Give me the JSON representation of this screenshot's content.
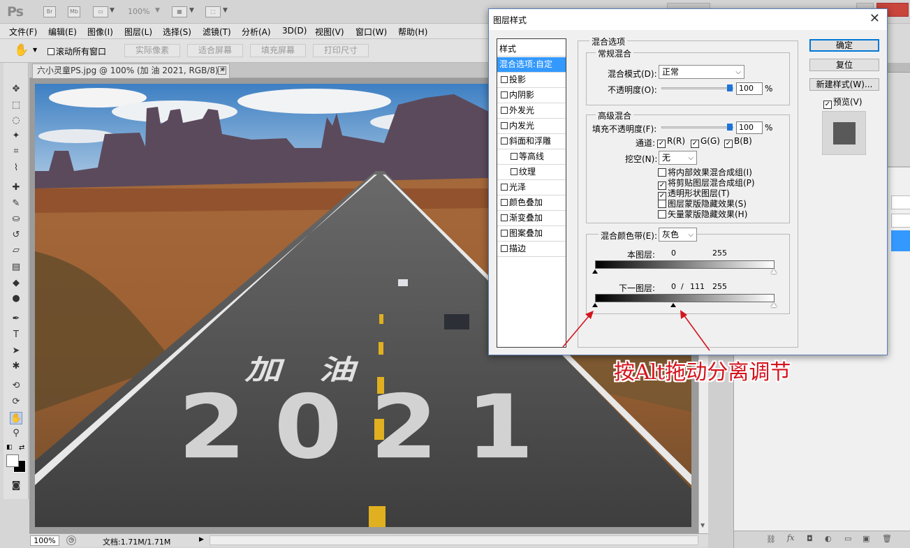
{
  "app": {
    "logo": "Ps",
    "titlebar_icons": [
      "Br",
      "Mb"
    ],
    "zoom": "100%"
  },
  "menu": [
    "文件(F)",
    "编辑(E)",
    "图像(I)",
    "图层(L)",
    "选择(S)",
    "滤镜(T)",
    "分析(A)",
    "3D(D)",
    "视图(V)",
    "窗口(W)",
    "帮助(H)"
  ],
  "options_bar": {
    "scroll_all": "滚动所有窗口",
    "actual_pixels": "实际像素",
    "fit_screen": "适合屏幕",
    "fill_screen": "填充屏幕",
    "print_size": "打印尺寸"
  },
  "document": {
    "tab_title": "六小灵童PS.jpg @ 100% (加 油 2021, RGB/8) *",
    "close": "✕",
    "zoom": "100%",
    "doc_info": "文档:1.71M/1.71M",
    "road_text_1": "加 油",
    "road_text_2": "2021"
  },
  "dialog": {
    "title": "图层样式",
    "close": "✕",
    "styles_header": "样式",
    "styles": [
      {
        "label": "混合选项:自定",
        "selected": true,
        "checkbox": false,
        "sub": false
      },
      {
        "label": "投影",
        "selected": false,
        "checkbox": true,
        "sub": false
      },
      {
        "label": "内阴影",
        "selected": false,
        "checkbox": true,
        "sub": false
      },
      {
        "label": "外发光",
        "selected": false,
        "checkbox": true,
        "sub": false
      },
      {
        "label": "内发光",
        "selected": false,
        "checkbox": true,
        "sub": false
      },
      {
        "label": "斜面和浮雕",
        "selected": false,
        "checkbox": true,
        "sub": false
      },
      {
        "label": "等高线",
        "selected": false,
        "checkbox": true,
        "sub": true
      },
      {
        "label": "纹理",
        "selected": false,
        "checkbox": true,
        "sub": true
      },
      {
        "label": "光泽",
        "selected": false,
        "checkbox": true,
        "sub": false
      },
      {
        "label": "颜色叠加",
        "selected": false,
        "checkbox": true,
        "sub": false
      },
      {
        "label": "渐变叠加",
        "selected": false,
        "checkbox": true,
        "sub": false
      },
      {
        "label": "图案叠加",
        "selected": false,
        "checkbox": true,
        "sub": false
      },
      {
        "label": "描边",
        "selected": false,
        "checkbox": true,
        "sub": false
      }
    ],
    "blend_options_title": "混合选项",
    "general_blending": "常规混合",
    "blend_mode_label": "混合模式(D):",
    "blend_mode_value": "正常",
    "opacity_label": "不透明度(O):",
    "opacity_value": "100",
    "percent": "%",
    "advanced_blending": "高级混合",
    "fill_opacity_label": "填充不透明度(F):",
    "fill_opacity_value": "100",
    "channels_label": "通道:",
    "channel_r": "R(R)",
    "channel_g": "G(G)",
    "channel_b": "B(B)",
    "knockout_label": "挖空(N):",
    "knockout_value": "无",
    "options": [
      {
        "label": "将内部效果混合成组(I)",
        "checked": false
      },
      {
        "label": "将剪贴图层混合成组(P)",
        "checked": true
      },
      {
        "label": "透明形状图层(T)",
        "checked": true
      },
      {
        "label": "图层蒙版隐藏效果(S)",
        "checked": false
      },
      {
        "label": "矢量蒙版隐藏效果(H)",
        "checked": false
      }
    ],
    "blend_if_label": "混合颜色带(E):",
    "blend_if_value": "灰色",
    "this_layer_label": "本图层:",
    "this_layer_low": "0",
    "this_layer_high": "255",
    "underlying_label": "下一图层:",
    "underlying_low": "0",
    "underlying_sep": "/",
    "underlying_mid": "111",
    "underlying_high": "255",
    "underlying_split_value": 111,
    "ok": "确定",
    "reset": "复位",
    "new_style": "新建样式(W)...",
    "preview": "预览(V)"
  },
  "annotation": "按Alt拖动分离调节",
  "colors": {
    "selection_blue": "#3399ff",
    "annotation_red": "#d4141e",
    "slider_blue": "#1e73d8"
  }
}
